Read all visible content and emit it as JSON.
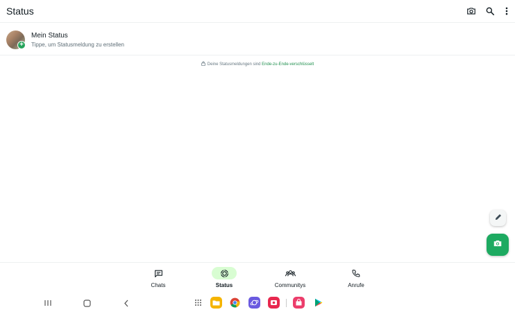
{
  "header": {
    "title": "Status",
    "icons": [
      "camera-icon",
      "search-icon",
      "more-vert-icon"
    ]
  },
  "my_status": {
    "name": "Mein Status",
    "subtitle": "Tippe, um Statusmeldung zu erstellen"
  },
  "encryption": {
    "text": "Deine Statusmeldungen sind ",
    "link": "Ende-zu-Ende-verschlüsselt"
  },
  "fabs": {
    "pencil": "pencil-icon",
    "camera": "camera-icon"
  },
  "bottom_nav": {
    "items": [
      {
        "label": "Chats",
        "icon": "chats-icon",
        "active": false
      },
      {
        "label": "Status",
        "icon": "status-icon",
        "active": true
      },
      {
        "label": "Communitys",
        "icon": "communities-icon",
        "active": false
      },
      {
        "label": "Anrufe",
        "icon": "calls-icon",
        "active": false
      }
    ]
  },
  "system_bar": {
    "nav_buttons": [
      "recents-icon",
      "home-icon",
      "back-icon"
    ],
    "dock_apps": [
      "app-drawer-icon",
      "my-files-icon",
      "chrome-icon",
      "samsung-internet-icon",
      "screen-recorder-icon",
      "galaxy-store-icon",
      "play-store-icon"
    ]
  },
  "colors": {
    "accent": "#1daa61",
    "active_pill": "#d8fdd2",
    "link": "#1f8f4e",
    "text_primary": "#111b21",
    "text_secondary": "#5e6e77"
  }
}
